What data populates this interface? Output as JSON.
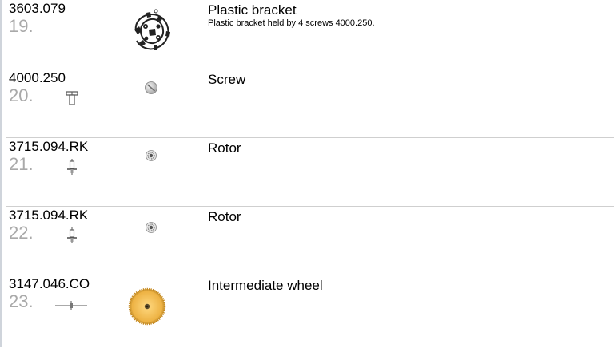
{
  "rows": [
    {
      "part_number": "3603.079",
      "step": "19.",
      "title": "Plastic bracket",
      "description": "Plastic bracket held by 4 screws 4000.250."
    },
    {
      "part_number": "4000.250",
      "step": "20.",
      "title": "Screw",
      "description": ""
    },
    {
      "part_number": "3715.094.RK",
      "step": "21.",
      "title": "Rotor",
      "description": ""
    },
    {
      "part_number": "3715.094.RK",
      "step": "22.",
      "title": "Rotor",
      "description": ""
    },
    {
      "part_number": "3147.046.CO",
      "step": "23.",
      "title": "Intermediate wheel",
      "description": ""
    }
  ],
  "colors": {
    "accent": "#f0b640",
    "step_number": "#a9a9a9",
    "divider": "#cfcfcf"
  }
}
